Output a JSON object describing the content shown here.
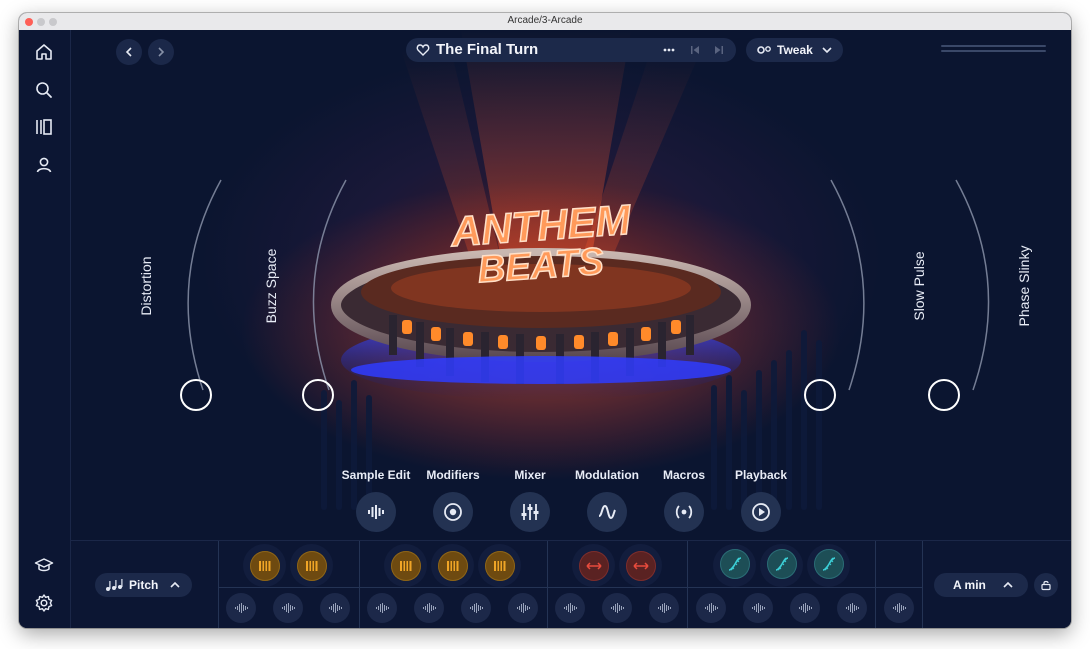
{
  "window": {
    "title": "Arcade/3-Arcade"
  },
  "sidebar": {
    "items": [
      "home-icon",
      "search-icon",
      "library-icon",
      "user-icon"
    ],
    "bottom_items": [
      "learn-icon",
      "settings-icon"
    ]
  },
  "header": {
    "track_name": "The Final Turn",
    "tweak_label": "Tweak"
  },
  "artwork": {
    "text": "ANTHEM BEATS"
  },
  "knobs": [
    {
      "label": "Distortion"
    },
    {
      "label": "Buzz Space"
    },
    {
      "label": "Slow Pulse"
    },
    {
      "label": "Phase Slinky"
    }
  ],
  "tools": [
    {
      "label": "Sample Edit",
      "icon": "waveform-icon"
    },
    {
      "label": "Modifiers",
      "icon": "target-icon"
    },
    {
      "label": "Mixer",
      "icon": "sliders-icon"
    },
    {
      "label": "Modulation",
      "icon": "wave-icon"
    },
    {
      "label": "Macros",
      "icon": "radio-icon"
    },
    {
      "label": "Playback",
      "icon": "play-circle-icon"
    }
  ],
  "bottom": {
    "pitch_label": "Pitch",
    "key_label": "A min"
  },
  "colors": {
    "accent_orange": "#f0a526",
    "accent_red": "#e84b3c",
    "accent_teal": "#3ccfd6",
    "bg": "#0b1530"
  }
}
